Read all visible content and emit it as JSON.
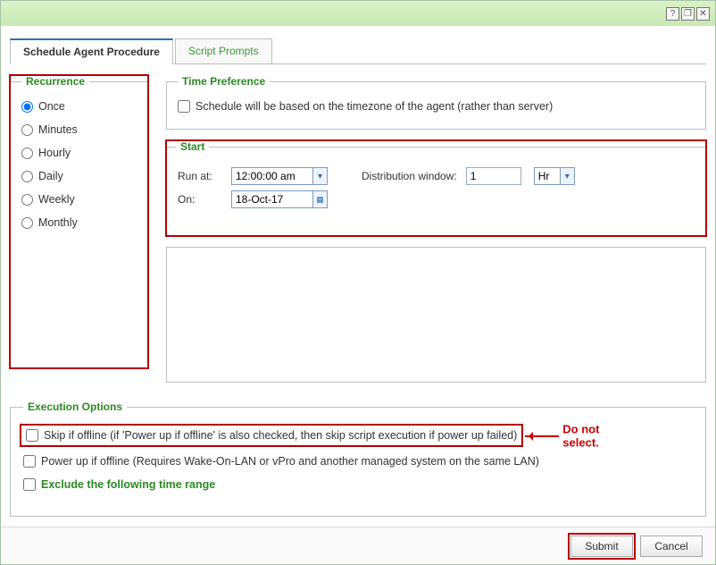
{
  "titlebar": {
    "help_icon": "?",
    "maximize_icon": "❐",
    "close_icon": "✕"
  },
  "tabs": {
    "schedule": "Schedule Agent Procedure",
    "prompts": "Script Prompts"
  },
  "recurrence": {
    "legend": "Recurrence",
    "options": {
      "once": "Once",
      "minutes": "Minutes",
      "hourly": "Hourly",
      "daily": "Daily",
      "weekly": "Weekly",
      "monthly": "Monthly"
    },
    "selected": "once"
  },
  "time_preference": {
    "legend": "Time Preference",
    "label": "Schedule will be based on the timezone of the agent (rather than server)"
  },
  "start": {
    "legend": "Start",
    "run_at_label": "Run at:",
    "run_at_value": "12:00:00 am",
    "on_label": "On:",
    "on_value": "18-Oct-17",
    "dist_label": "Distribution window:",
    "dist_value": "1",
    "dist_unit": "Hr"
  },
  "execution": {
    "legend": "Execution Options",
    "skip_label": "Skip if offline (if 'Power up if offline' is also checked, then skip script execution if power up failed)",
    "powerup_label": "Power up if offline (Requires Wake-On-LAN or vPro and another managed system on the same LAN)",
    "exclude_label": "Exclude the following time range"
  },
  "annotation": {
    "do_not_select": "Do not select."
  },
  "footer": {
    "submit": "Submit",
    "cancel": "Cancel"
  }
}
